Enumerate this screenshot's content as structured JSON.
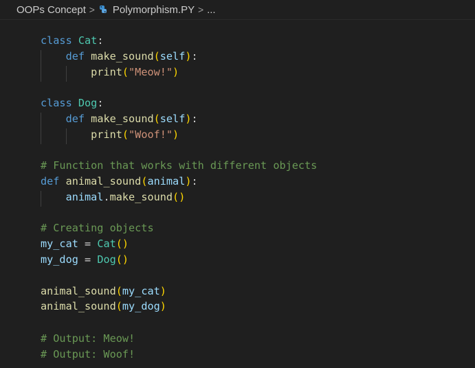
{
  "breadcrumb": {
    "folder": "OOPs Concept",
    "file": "Polymorphism.PY",
    "more": "...",
    "separator": ">"
  },
  "colors": {
    "background": "#1f1f1f",
    "keyword": "#569cd6",
    "function": "#dcdcaa",
    "class_name": "#4ec9b0",
    "variable": "#9cdcfe",
    "string": "#ce9178",
    "comment": "#6a9955",
    "bracket": "#ffd700",
    "python_icon": "#3b8fd1"
  },
  "code": {
    "l1_kw": "class",
    "l1_name": "Cat",
    "l1_colon": ":",
    "l2_kw": "def",
    "l2_fn": "make_sound",
    "l2_open": "(",
    "l2_param": "self",
    "l2_close": ")",
    "l2_colon": ":",
    "l3_fn": "print",
    "l3_open": "(",
    "l3_str": "\"Meow!\"",
    "l3_close": ")",
    "l4_kw": "class",
    "l4_name": "Dog",
    "l4_colon": ":",
    "l5_kw": "def",
    "l5_fn": "make_sound",
    "l5_open": "(",
    "l5_param": "self",
    "l5_close": ")",
    "l5_colon": ":",
    "l6_fn": "print",
    "l6_open": "(",
    "l6_str": "\"Woof!\"",
    "l6_close": ")",
    "l7_comment": "# Function that works with different objects",
    "l8_kw": "def",
    "l8_fn": "animal_sound",
    "l8_open": "(",
    "l8_param": "animal",
    "l8_close": ")",
    "l8_colon": ":",
    "l9_obj": "animal",
    "l9_dot": ".",
    "l9_fn": "make_sound",
    "l9_parens": "()",
    "l10_comment": "# Creating objects",
    "l11_var": "my_cat",
    "l11_eq": " = ",
    "l11_cls": "Cat",
    "l11_parens": "()",
    "l12_var": "my_dog",
    "l12_eq": " = ",
    "l12_cls": "Dog",
    "l12_parens": "()",
    "l13_fn": "animal_sound",
    "l13_open": "(",
    "l13_arg": "my_cat",
    "l13_close": ")",
    "l14_fn": "animal_sound",
    "l14_open": "(",
    "l14_arg": "my_dog",
    "l14_close": ")",
    "l15_comment": "# Output: Meow!",
    "l16_comment": "# Output: Woof!"
  }
}
